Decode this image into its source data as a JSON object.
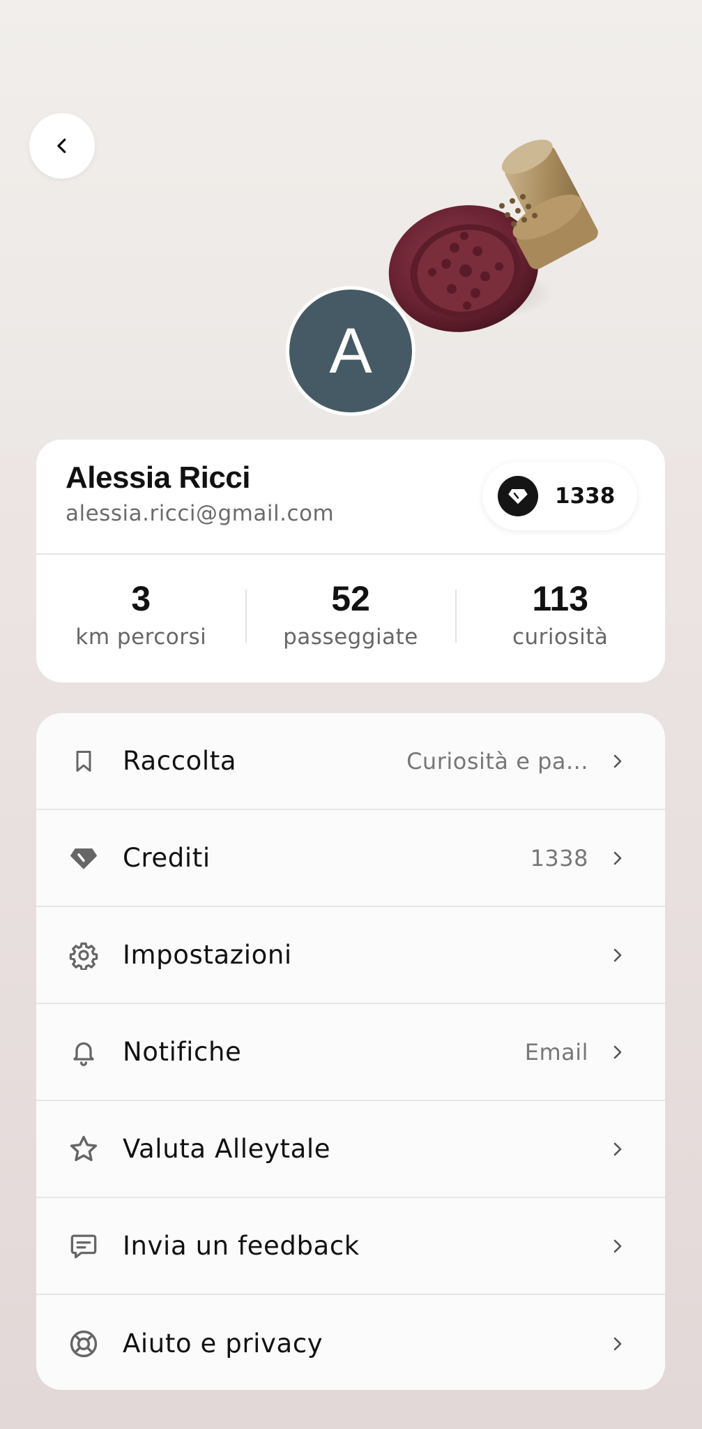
{
  "colors": {
    "avatar_bg": "#455a64",
    "text_primary": "#111111",
    "text_secondary": "#6b6b6b",
    "icon_gray": "#666666"
  },
  "header": {
    "back_icon": "chevron-left-icon",
    "avatar_letter": "A"
  },
  "profile": {
    "name": "Alessia Ricci",
    "email": "alessia.ricci@gmail.com",
    "credits_icon": "diamond-icon",
    "credits": "1338"
  },
  "stats": [
    {
      "value": "3",
      "label": "km percorsi"
    },
    {
      "value": "52",
      "label": "passeggiate"
    },
    {
      "value": "113",
      "label": "curiosità"
    }
  ],
  "menu": [
    {
      "icon": "bookmark-icon",
      "label": "Raccolta",
      "value": "Curiosità e pa..."
    },
    {
      "icon": "diamond-icon",
      "label": "Crediti",
      "value": "1338"
    },
    {
      "icon": "gear-icon",
      "label": "Impostazioni",
      "value": ""
    },
    {
      "icon": "bell-icon",
      "label": "Notifiche",
      "value": "Email"
    },
    {
      "icon": "star-icon",
      "label": "Valuta Alleytale",
      "value": ""
    },
    {
      "icon": "message-icon",
      "label": "Invia un feedback",
      "value": ""
    },
    {
      "icon": "lifebuoy-icon",
      "label": "Aiuto e privacy",
      "value": ""
    }
  ]
}
